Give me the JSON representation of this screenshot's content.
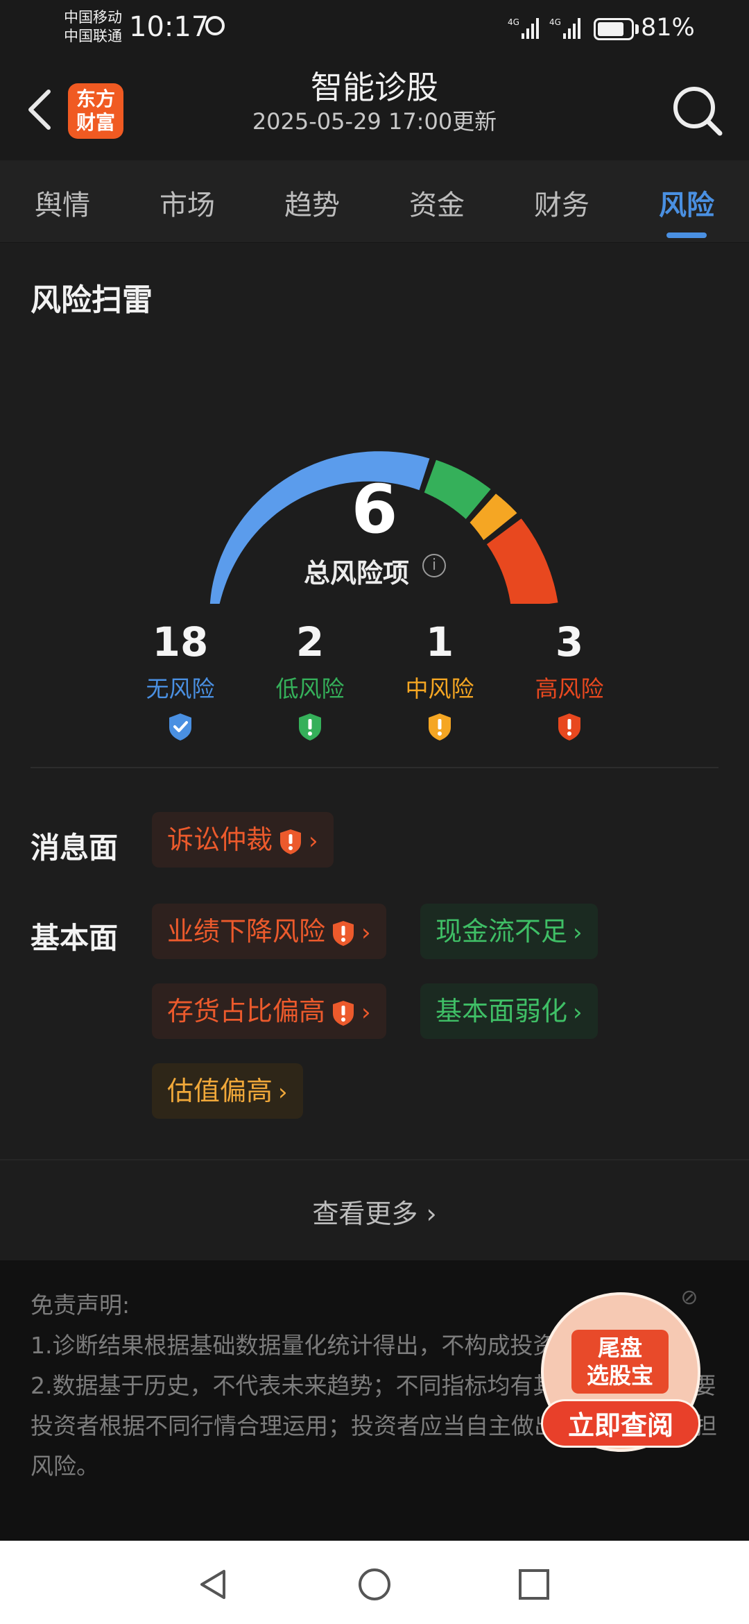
{
  "status_bar": {
    "carrier_1": "中国移动",
    "carrier_2": "中国联通",
    "time": "10:17",
    "network_1": "4G",
    "network_2": "4G",
    "battery_percent": "81%",
    "battery_level": 0.81
  },
  "header": {
    "logo_line_1": "东方",
    "logo_line_2": "财富",
    "title": "智能诊股",
    "subtitle": "2025-05-29 17:00更新"
  },
  "tabs": [
    {
      "label": "舆情",
      "active": false
    },
    {
      "label": "市场",
      "active": false
    },
    {
      "label": "趋势",
      "active": false
    },
    {
      "label": "资金",
      "active": false
    },
    {
      "label": "财务",
      "active": false
    },
    {
      "label": "风险",
      "active": true
    }
  ],
  "risk": {
    "section_title": "风险扫雷",
    "total": "6",
    "total_label": "总风险项",
    "gauge_segments": [
      {
        "name": "无风险",
        "share": 0.6,
        "color": "#5b9cec"
      },
      {
        "name": "低风险",
        "share": 0.11,
        "color": "#35b05a"
      },
      {
        "name": "中风险",
        "share": 0.05,
        "color": "#f5a623"
      },
      {
        "name": "高风险",
        "share": 0.16,
        "color": "#e8481f"
      }
    ],
    "stats": [
      {
        "count": "18",
        "label": "无风险",
        "color": "#4a90e2",
        "icon": "shield-check-icon"
      },
      {
        "count": "2",
        "label": "低风险",
        "color": "#35b05a",
        "icon": "shield-exclamation-icon"
      },
      {
        "count": "1",
        "label": "中风险",
        "color": "#f5a623",
        "icon": "shield-exclamation-icon"
      },
      {
        "count": "3",
        "label": "高风险",
        "color": "#e8481f",
        "icon": "shield-exclamation-icon"
      }
    ]
  },
  "categories": {
    "news": {
      "label": "消息面",
      "items": [
        {
          "text": "诉讼仲裁",
          "level": "high"
        }
      ]
    },
    "fundamental": {
      "label": "基本面",
      "items": [
        {
          "text": "业绩下降风险",
          "level": "high"
        },
        {
          "text": "现金流不足",
          "level": "low"
        },
        {
          "text": "存货占比偏高",
          "level": "high"
        },
        {
          "text": "基本面弱化",
          "level": "low"
        },
        {
          "text": "估值偏高",
          "level": "medium"
        }
      ]
    }
  },
  "more": {
    "label": "查看更多"
  },
  "disclaimer": {
    "title": "免责声明:",
    "line_1": "1.诊断结果根据基础数据量化统计得出，不构成投资建议。",
    "line_2": "2.数据基于历史，不代表未来趋势；不同指标均有其适用范围，需要投资者根据不同行情合理运用；投资者应当自主做出判断，自行承担风险。"
  },
  "float_ad": {
    "title_line_1": "尾盘",
    "title_line_2": "选股宝",
    "button": "立即查阅"
  },
  "colors": {
    "accent": "#4a90e2",
    "high_risk": "#ec5a2c",
    "low_risk": "#3fbf66",
    "medium_risk": "#f0a83a"
  }
}
